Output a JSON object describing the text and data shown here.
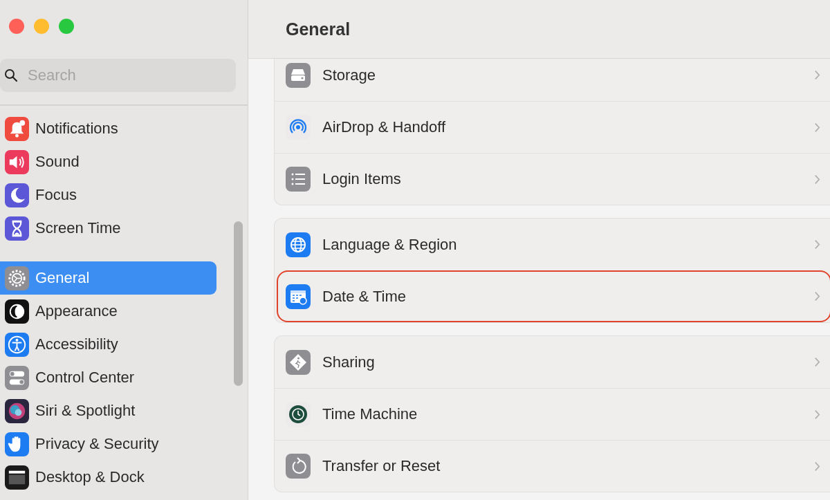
{
  "window": {
    "title": "General"
  },
  "sidebar": {
    "search": {
      "placeholder": "Search"
    },
    "groups": [
      {
        "items": [
          {
            "label": "Notifications",
            "selected": false
          },
          {
            "label": "Sound",
            "selected": false
          },
          {
            "label": "Focus",
            "selected": false
          },
          {
            "label": "Screen Time",
            "selected": false
          }
        ]
      },
      {
        "items": [
          {
            "label": "General",
            "selected": true
          },
          {
            "label": "Appearance",
            "selected": false
          },
          {
            "label": "Accessibility",
            "selected": false
          },
          {
            "label": "Control Center",
            "selected": false
          },
          {
            "label": "Siri & Spotlight",
            "selected": false
          },
          {
            "label": "Privacy & Security",
            "selected": false
          },
          {
            "label": "Desktop & Dock",
            "selected": false
          }
        ]
      }
    ]
  },
  "content": {
    "groups": [
      {
        "rows": [
          {
            "label": "Storage",
            "highlighted": false
          },
          {
            "label": "AirDrop & Handoff",
            "highlighted": false
          },
          {
            "label": "Login Items",
            "highlighted": false
          }
        ]
      },
      {
        "rows": [
          {
            "label": "Language & Region",
            "highlighted": false
          },
          {
            "label": "Date & Time",
            "highlighted": true
          }
        ]
      },
      {
        "rows": [
          {
            "label": "Sharing",
            "highlighted": false
          },
          {
            "label": "Time Machine",
            "highlighted": false
          },
          {
            "label": "Transfer or Reset",
            "highlighted": false
          }
        ]
      }
    ]
  }
}
